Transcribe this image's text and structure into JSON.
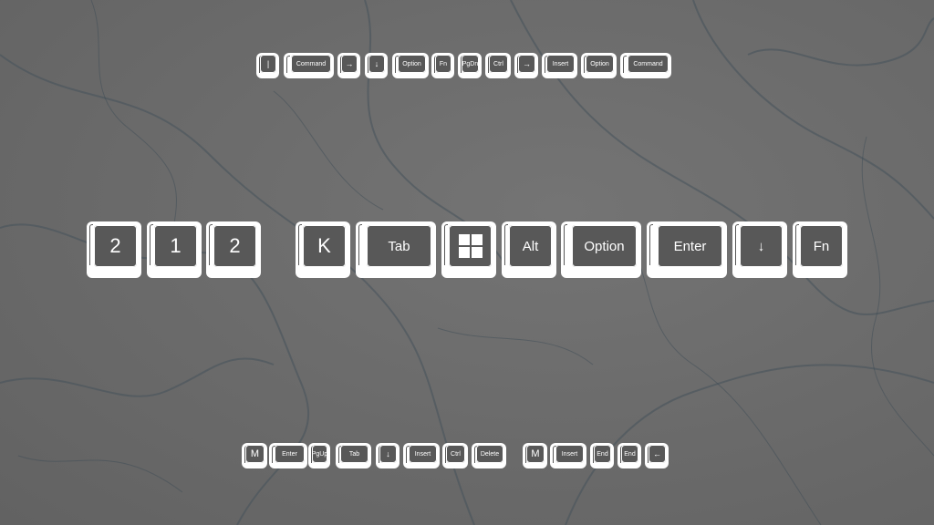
{
  "rows": {
    "top": [
      "|",
      "Command",
      "→",
      "↓",
      "Option",
      "Fn",
      "PgDn",
      "Ctrl",
      "→",
      "Insert",
      "Option",
      "Command"
    ],
    "middle": [
      "2",
      "1",
      "2",
      "K",
      "Tab",
      "windows-logo-icon",
      "Alt",
      "Option",
      "Enter",
      "↓",
      "Fn"
    ],
    "bottom": [
      "M",
      "Enter",
      "PgUp",
      "Tab",
      "↓",
      "Insert",
      "Ctrl",
      "Delete",
      "M",
      "Insert",
      "End",
      "End",
      "←"
    ]
  },
  "colors": {
    "background": "#6b6b6b",
    "key": "#ffffff",
    "key_face": "#585858",
    "vein": "#3f4d57"
  }
}
